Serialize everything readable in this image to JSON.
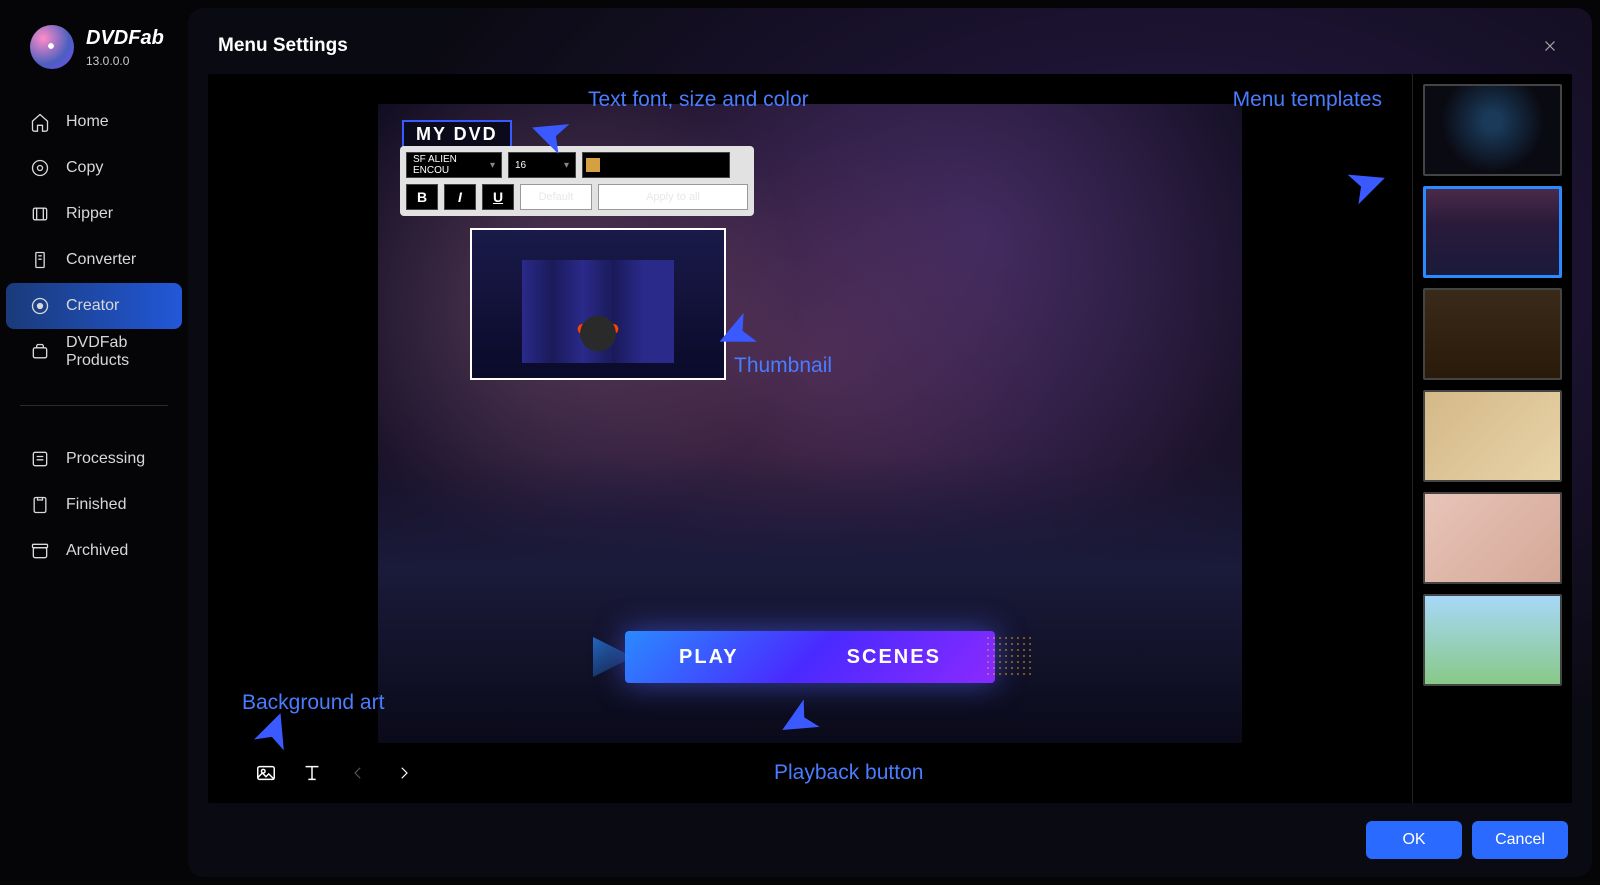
{
  "brand": {
    "name": "DVDFab",
    "version": "13.0.0.0"
  },
  "sidebar": {
    "items": [
      {
        "label": "Home",
        "icon": "home"
      },
      {
        "label": "Copy",
        "icon": "copy"
      },
      {
        "label": "Ripper",
        "icon": "ripper"
      },
      {
        "label": "Converter",
        "icon": "converter"
      },
      {
        "label": "Creator",
        "icon": "creator",
        "active": true
      },
      {
        "label": "DVDFab Products",
        "icon": "products"
      }
    ],
    "items2": [
      {
        "label": "Processing",
        "icon": "processing"
      },
      {
        "label": "Finished",
        "icon": "finished"
      },
      {
        "label": "Archived",
        "icon": "archived"
      }
    ]
  },
  "dialog": {
    "title": "Menu Settings",
    "ok_label": "OK",
    "cancel_label": "Cancel"
  },
  "editor": {
    "dvd_title": "MY DVD",
    "font_name": "SF ALIEN ENCOU",
    "font_size": "16",
    "color": "#d4a040",
    "default_btn": "Default",
    "apply_btn": "Apply to all",
    "play_label": "PLAY",
    "scenes_label": "SCENES"
  },
  "annotations": {
    "text_font": "Text font, size and color",
    "menu_templates": "Menu templates",
    "thumbnail": "Thumbnail",
    "background_art": "Background art",
    "playback_button": "Playback button"
  },
  "templates": {
    "count": 6,
    "selected_index": 1
  }
}
